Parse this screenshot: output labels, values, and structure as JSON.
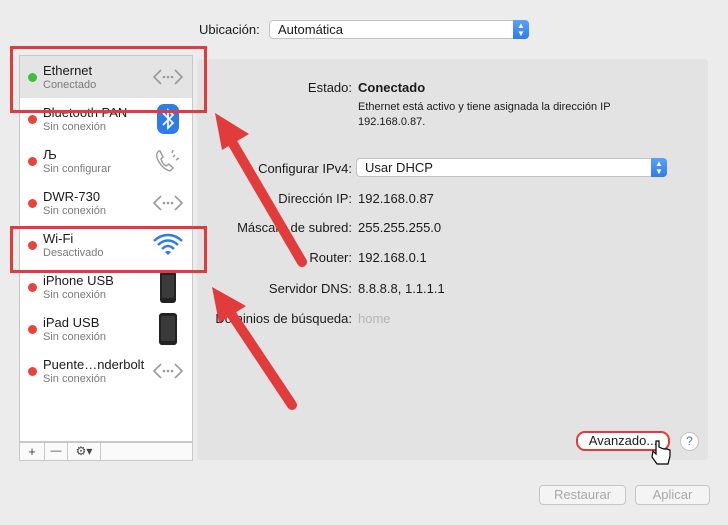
{
  "location": {
    "label": "Ubicación:",
    "value": "Automática"
  },
  "services": [
    {
      "name": "Ethernet",
      "status": "Conectado",
      "dot": "#3cc13a",
      "icon": "ethernet-icon"
    },
    {
      "name": "Bluetooth PAN",
      "status": "Sin conexión",
      "dot": "#e8443c",
      "icon": "bluetooth-icon"
    },
    {
      "name": "Љ",
      "status": "Sin configurar",
      "dot": "#e8443c",
      "icon": "phone-icon"
    },
    {
      "name": "DWR-730",
      "status": "Sin conexión",
      "dot": "#e8443c",
      "icon": "ethernet-icon"
    },
    {
      "name": "Wi-Fi",
      "status": "Desactivado",
      "dot": "#e8443c",
      "icon": "wifi-icon"
    },
    {
      "name": "iPhone USB",
      "status": "Sin conexión",
      "dot": "#e8443c",
      "icon": "iphone-icon"
    },
    {
      "name": "iPad USB",
      "status": "Sin conexión",
      "dot": "#e8443c",
      "icon": "ipad-icon"
    },
    {
      "name": "Puente…nderbolt",
      "status": "Sin conexión",
      "dot": "#e8443c",
      "icon": "ethernet-icon"
    }
  ],
  "toolbar": {
    "add": "+",
    "remove": "—",
    "gear": "⚙▾"
  },
  "detail": {
    "status_label": "Estado:",
    "status_value": "Conectado",
    "status_desc_1": "Ethernet está activo y tiene asignada la dirección IP",
    "status_desc_2": "192.168.0.87.",
    "ipv4_label": "Configurar IPv4:",
    "ipv4_value": "Usar DHCP",
    "ip_label": "Dirección IP:",
    "ip_value": "192.168.0.87",
    "mask_label": "Máscara de subred:",
    "mask_value": "255.255.255.0",
    "router_label": "Router:",
    "router_value": "192.168.0.1",
    "dns_label": "Servidor DNS:",
    "dns_value": "8.8.8.8, 1.1.1.1",
    "search_label": "Dominios de búsqueda:",
    "search_placeholder": "home"
  },
  "buttons": {
    "advanced": "Avanzado...",
    "help": "?",
    "revert": "Restaurar",
    "apply": "Aplicar"
  },
  "colors": {
    "annotation_red": "#e23b3b",
    "accent_blue": "#2d7ce8",
    "connected_green": "#3cc13a",
    "disconnected_red": "#e8443c"
  }
}
